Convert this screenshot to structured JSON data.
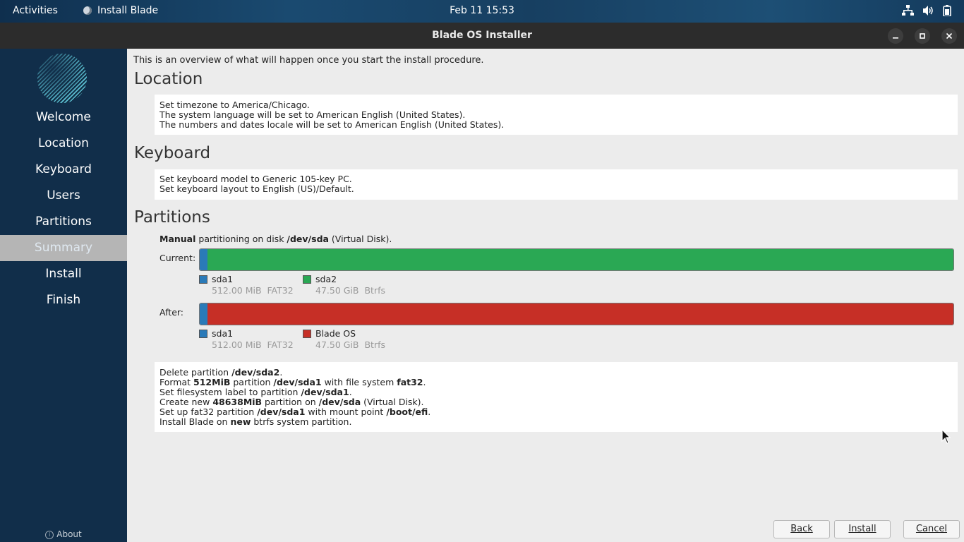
{
  "topbar": {
    "activities": "Activities",
    "app_name": "Install Blade",
    "datetime": "Feb 11  15:53"
  },
  "window": {
    "title": "Blade OS Installer"
  },
  "sidebar": {
    "steps": [
      "Welcome",
      "Location",
      "Keyboard",
      "Users",
      "Partitions",
      "Summary",
      "Install",
      "Finish"
    ],
    "active_step": "Summary",
    "about": "About"
  },
  "summary": {
    "intro": "This is an overview of what will happen once you start the install procedure.",
    "location": {
      "title": "Location",
      "lines": [
        "Set timezone to America/Chicago.",
        "The system language will be set to American English (United States).",
        "The numbers and dates locale will be set to American English (United States)."
      ]
    },
    "keyboard": {
      "title": "Keyboard",
      "lines": [
        "Set keyboard model to Generic 105-key PC.",
        "Set keyboard layout to English (US)/Default."
      ]
    },
    "partitions": {
      "title": "Partitions",
      "header": {
        "mode": "Manual",
        "mid": " partitioning on disk ",
        "disk": "/dev/sda",
        "tail": " (Virtual Disk)."
      },
      "current_label": "Current:",
      "after_label": "After:",
      "current": [
        {
          "name": "sda1",
          "size": "512.00 MiB",
          "fs": "FAT32",
          "color": "#2a7ab8",
          "fraction": 0.0104
        },
        {
          "name": "sda2",
          "size": "47.50 GiB",
          "fs": "Btrfs",
          "color": "#2aa854",
          "fraction": 0.9896
        }
      ],
      "after": [
        {
          "name": "sda1",
          "size": "512.00 MiB",
          "fs": "FAT32",
          "color": "#2a7ab8",
          "fraction": 0.0104
        },
        {
          "name": "Blade OS",
          "size": "47.50 GiB",
          "fs": "Btrfs",
          "color": "#c62f26",
          "fraction": 0.9896
        }
      ],
      "jobs": [
        [
          {
            "t": "Delete partition "
          },
          {
            "t": "/dev/sda2",
            "b": true
          },
          {
            "t": "."
          }
        ],
        [
          {
            "t": "Format "
          },
          {
            "t": "512MiB",
            "b": true
          },
          {
            "t": " partition "
          },
          {
            "t": "/dev/sda1",
            "b": true
          },
          {
            "t": " with file system "
          },
          {
            "t": "fat32",
            "b": true
          },
          {
            "t": "."
          }
        ],
        [
          {
            "t": "Set filesystem label to partition "
          },
          {
            "t": "/dev/sda1",
            "b": true
          },
          {
            "t": "."
          }
        ],
        [
          {
            "t": "Create new "
          },
          {
            "t": "48638MiB",
            "b": true
          },
          {
            "t": " partition on "
          },
          {
            "t": "/dev/sda",
            "b": true
          },
          {
            "t": " (Virtual Disk)."
          }
        ],
        [
          {
            "t": "Set up fat32 partition "
          },
          {
            "t": "/dev/sda1",
            "b": true
          },
          {
            "t": " with mount point "
          },
          {
            "t": "/boot/efi",
            "b": true
          },
          {
            "t": "."
          }
        ],
        [
          {
            "t": "Install Blade on "
          },
          {
            "t": "new",
            "b": true
          },
          {
            "t": " btrfs system partition."
          }
        ]
      ]
    }
  },
  "buttons": {
    "back": "Back",
    "install": "Install",
    "cancel": "Cancel"
  }
}
